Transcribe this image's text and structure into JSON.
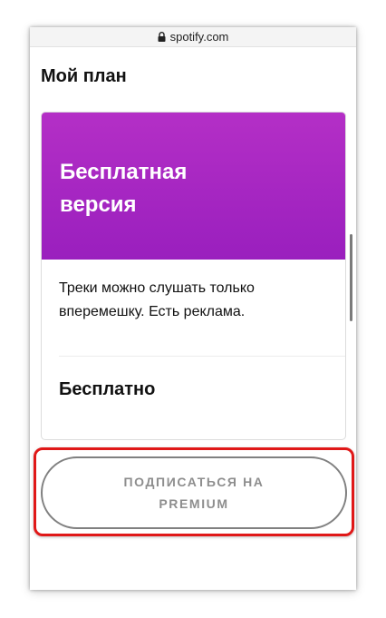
{
  "browser": {
    "url": "spotify.com",
    "lock_icon": "lock-icon"
  },
  "page": {
    "title": "Мой план"
  },
  "plan": {
    "name": "Бесплатная версия",
    "description": "Треки можно слушать только вперемешку. Есть реклама.",
    "price": "Бесплатно",
    "header_color": "#a826c2"
  },
  "actions": {
    "subscribe_label": "ПОДПИСАТЬСЯ НА PREMIUM",
    "highlight_color": "#e01818"
  }
}
